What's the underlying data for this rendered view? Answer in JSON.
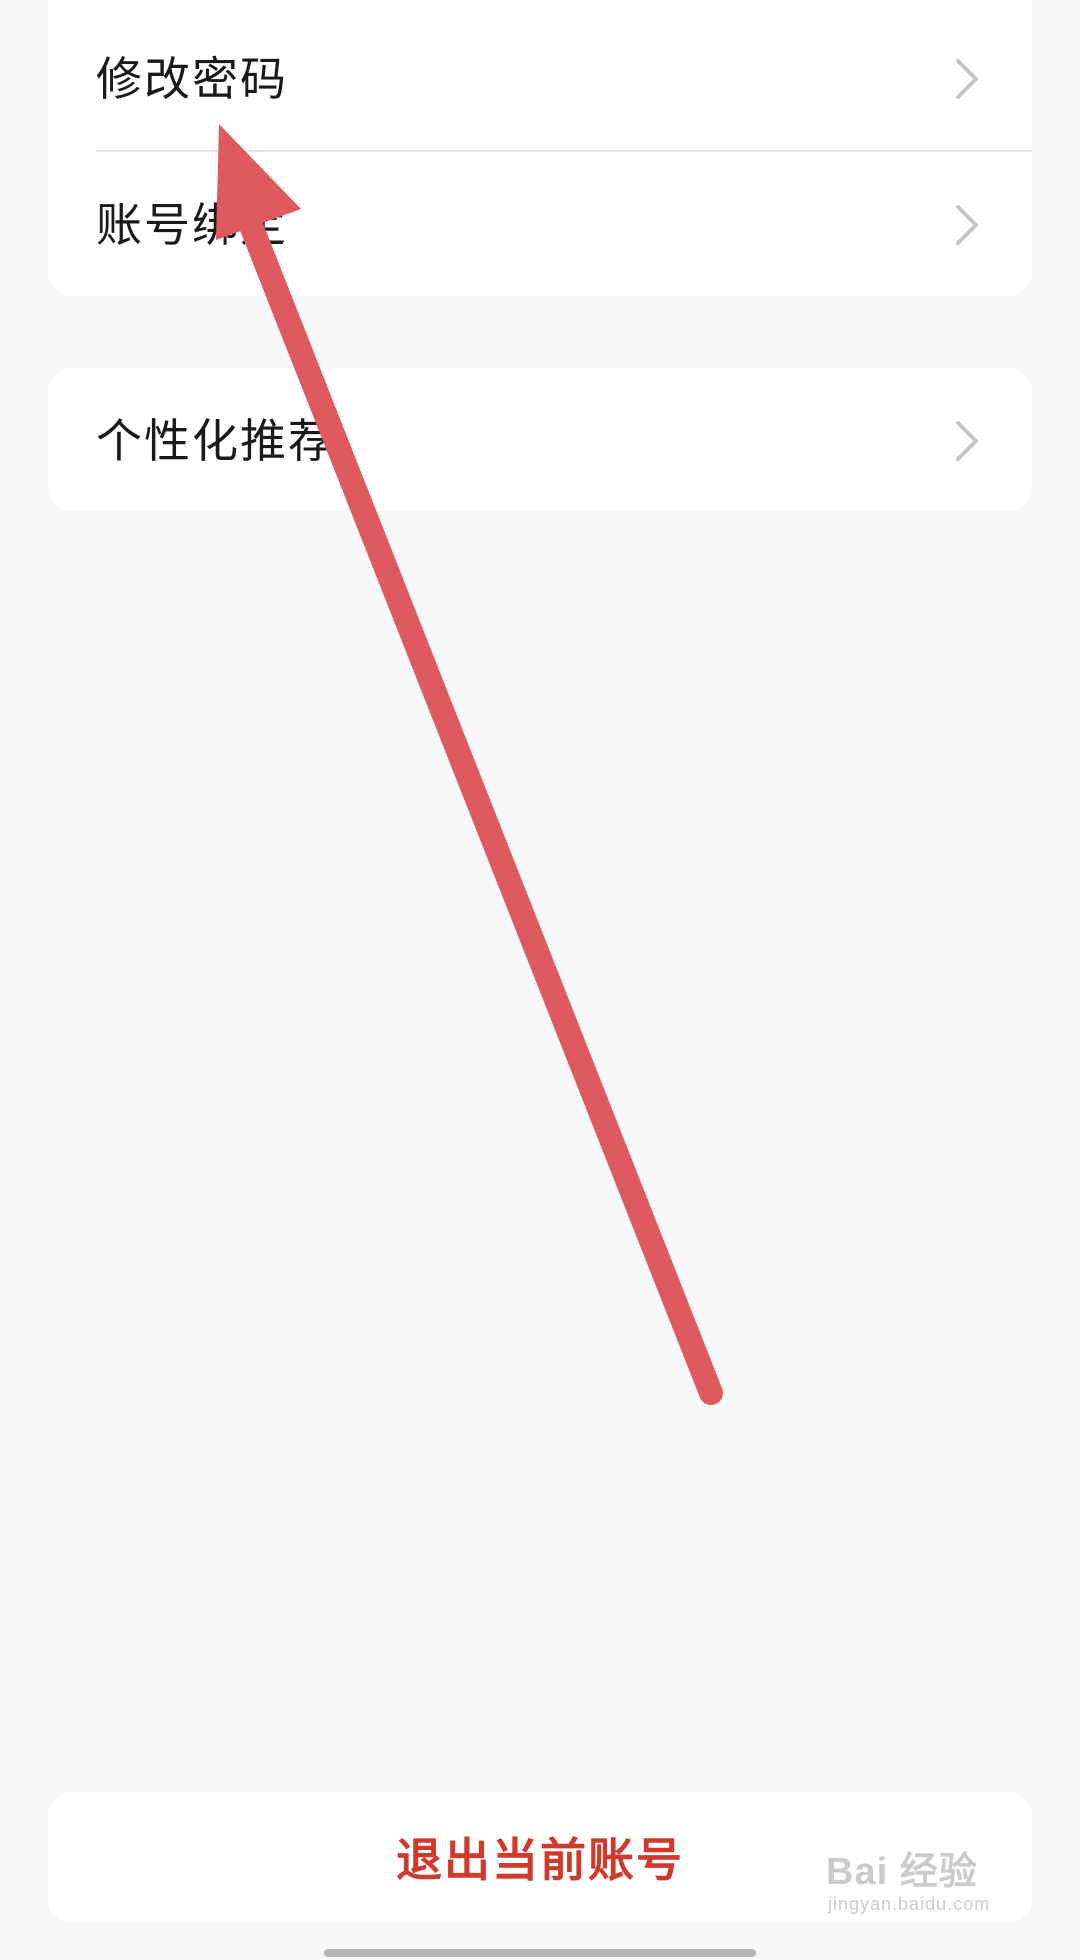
{
  "settings": {
    "items_group1": [
      {
        "label": "修改密码",
        "icon": "chevron-right-icon"
      },
      {
        "label": "账号绑定",
        "icon": "chevron-right-icon"
      }
    ],
    "items_group2": [
      {
        "label": "个性化推荐",
        "icon": "chevron-right-icon"
      }
    ]
  },
  "logout": {
    "label": "退出当前账号",
    "color": "#cf3a2c"
  },
  "watermark": {
    "brand": "Bai 经验",
    "sub": "jingyan.baidu.com"
  },
  "annotation": {
    "arrow_color": "#de5a60",
    "arrow_icon": "red-arrow-annotation"
  },
  "colors": {
    "background": "#f5f7f9",
    "card": "#ffffff",
    "text": "#1a1a1a",
    "chevron": "#c4c4c4"
  }
}
